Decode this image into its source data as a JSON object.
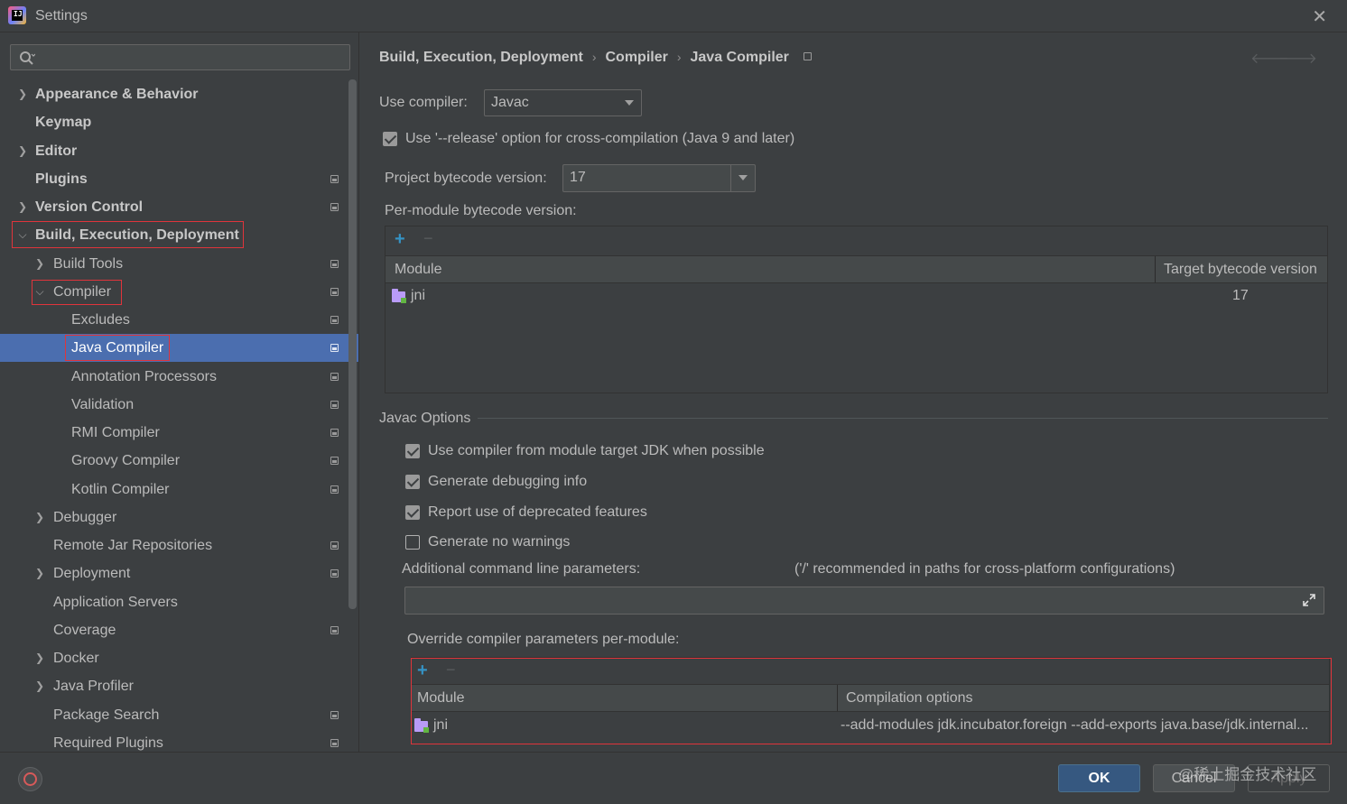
{
  "window": {
    "title": "Settings"
  },
  "search": {
    "placeholder": ""
  },
  "sidebar": {
    "items": [
      {
        "label": "Appearance & Behavior"
      },
      {
        "label": "Keymap"
      },
      {
        "label": "Editor"
      },
      {
        "label": "Plugins"
      },
      {
        "label": "Version Control"
      },
      {
        "label": "Build, Execution, Deployment"
      },
      {
        "label": "Build Tools"
      },
      {
        "label": "Compiler"
      },
      {
        "label": "Excludes"
      },
      {
        "label": "Java Compiler"
      },
      {
        "label": "Annotation Processors"
      },
      {
        "label": "Validation"
      },
      {
        "label": "RMI Compiler"
      },
      {
        "label": "Groovy Compiler"
      },
      {
        "label": "Kotlin Compiler"
      },
      {
        "label": "Debugger"
      },
      {
        "label": "Remote Jar Repositories"
      },
      {
        "label": "Deployment"
      },
      {
        "label": "Application Servers"
      },
      {
        "label": "Coverage"
      },
      {
        "label": "Docker"
      },
      {
        "label": "Java Profiler"
      },
      {
        "label": "Package Search"
      },
      {
        "label": "Required Plugins"
      }
    ]
  },
  "breadcrumb": {
    "part1": "Build, Execution, Deployment",
    "part2": "Compiler",
    "part3": "Java Compiler",
    "sep": "›"
  },
  "compiler": {
    "use_compiler_label": "Use compiler:",
    "use_compiler_value": "Javac",
    "release_option_label": "Use '--release' option for cross-compilation (Java 9 and later)",
    "release_option_checked": true,
    "project_bytecode_label": "Project bytecode version:",
    "project_bytecode_value": "17",
    "per_module_label": "Per-module bytecode version:"
  },
  "per_module_table": {
    "plus": "+",
    "minus": "−",
    "headers": [
      "Module",
      "Target bytecode version"
    ],
    "rows": [
      {
        "module": "jni",
        "version": "17"
      }
    ]
  },
  "javac": {
    "section_title": "Javac Options",
    "options": [
      {
        "label": "Use compiler from module target JDK when possible",
        "checked": true
      },
      {
        "label": "Generate debugging info",
        "checked": true
      },
      {
        "label": "Report use of deprecated features",
        "checked": true
      },
      {
        "label": "Generate no warnings",
        "checked": false
      }
    ],
    "additional_params_label": "Additional command line parameters:",
    "additional_params_hint": "('/' recommended in paths for cross-platform configurations)",
    "additional_params_value": "",
    "override_label": "Override compiler parameters per-module:"
  },
  "override_table": {
    "plus": "+",
    "minus": "−",
    "headers": [
      "Module",
      "Compilation options"
    ],
    "rows": [
      {
        "module": "jni",
        "options": "--add-modules jdk.incubator.foreign --add-exports java.base/jdk.internal..."
      }
    ]
  },
  "footer": {
    "ok": "OK",
    "cancel": "Cancel",
    "apply": "Apply",
    "watermark": "@稀土掘金技术社区"
  },
  "colors": {
    "background": "#3c3f41",
    "selection": "#4b6eaf",
    "highlight_box": "#e0343b",
    "accent_plus": "#3592c4",
    "ok_button": "#365880"
  }
}
